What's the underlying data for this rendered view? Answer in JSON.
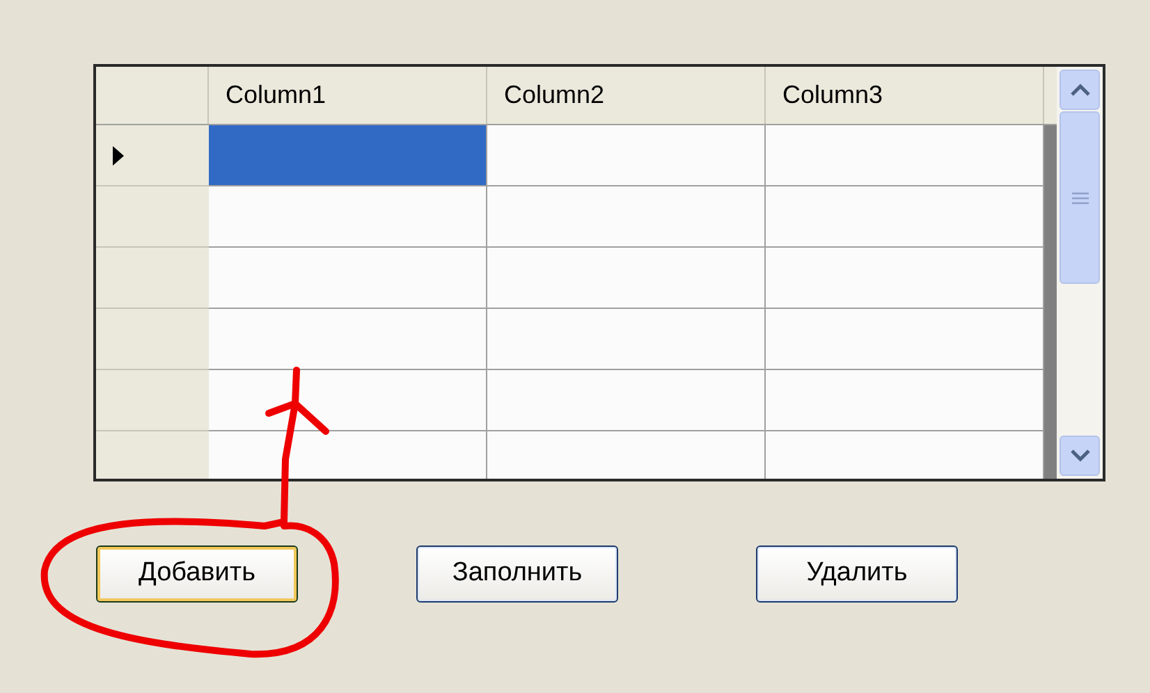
{
  "grid": {
    "columns": [
      "Column1",
      "Column2",
      "Column3"
    ],
    "rows": [
      {
        "current": true,
        "cells": [
          {
            "selected": true
          },
          {
            "selected": false
          },
          {
            "selected": false
          }
        ]
      },
      {
        "current": false,
        "cells": [
          {
            "selected": false
          },
          {
            "selected": false
          },
          {
            "selected": false
          }
        ]
      },
      {
        "current": false,
        "cells": [
          {
            "selected": false
          },
          {
            "selected": false
          },
          {
            "selected": false
          }
        ]
      },
      {
        "current": false,
        "cells": [
          {
            "selected": false
          },
          {
            "selected": false
          },
          {
            "selected": false
          }
        ]
      },
      {
        "current": false,
        "cells": [
          {
            "selected": false
          },
          {
            "selected": false
          },
          {
            "selected": false
          }
        ]
      },
      {
        "current": false,
        "cells": [
          {
            "selected": false
          },
          {
            "selected": false
          },
          {
            "selected": false
          }
        ]
      }
    ]
  },
  "buttons": [
    {
      "label": "Добавить",
      "focused": true
    },
    {
      "label": "Заполнить",
      "focused": false
    },
    {
      "label": "Удалить",
      "focused": false
    }
  ]
}
